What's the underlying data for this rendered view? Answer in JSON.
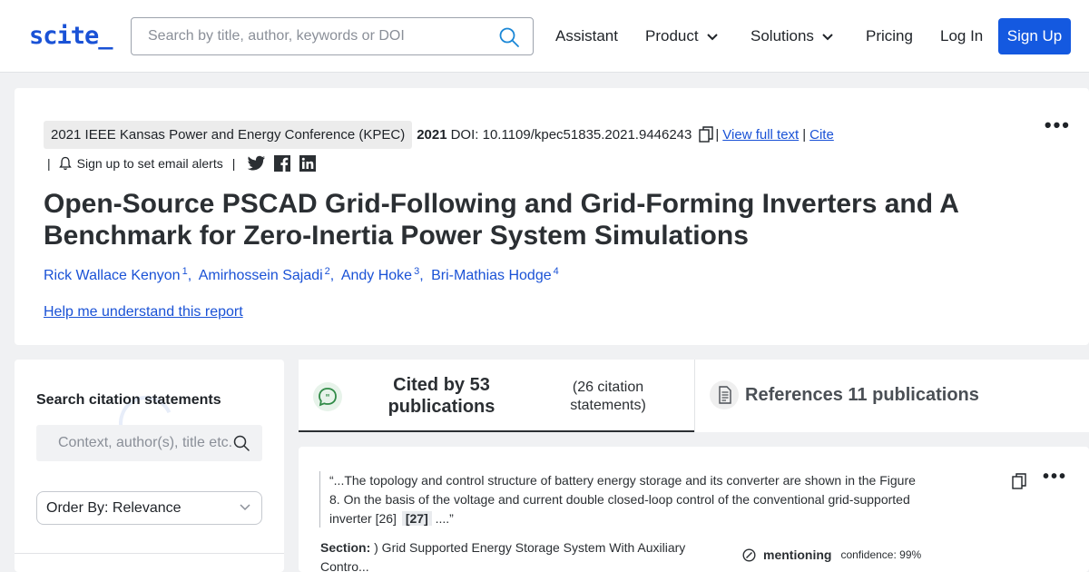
{
  "header": {
    "logo": "scite_",
    "search_placeholder": "Search by title, author, keywords or DOI",
    "nav": {
      "assistant": "Assistant",
      "product": "Product",
      "solutions": "Solutions",
      "pricing": "Pricing",
      "login": "Log In",
      "signup": "Sign Up"
    },
    "brand_color": "#1459e0"
  },
  "paper": {
    "venue": "2021 IEEE Kansas Power and Energy Conference (KPEC)",
    "year": "2021",
    "doi": "DOI: 10.1109/kpec51835.2021.9446243",
    "view_full_text": "View full text",
    "cite": "Cite",
    "sep": "|",
    "email_alerts": "Sign up to set email alerts",
    "title": "Open-Source PSCAD Grid-Following and Grid-Forming Inverters and A Benchmark for Zero-Inertia Power System Simulations",
    "authors": [
      {
        "name": "Rick Wallace Kenyon",
        "sup": "1"
      },
      {
        "name": "Amirhossein Sajadi",
        "sup": "2"
      },
      {
        "name": "Andy Hoke",
        "sup": "3"
      },
      {
        "name": "Bri-Mathias Hodge",
        "sup": "4"
      }
    ],
    "help_link": "Help me understand this report"
  },
  "sidebar": {
    "title": "Search citation statements",
    "search_placeholder": "Context, author(s), title etc.",
    "order_by": "Order By: Relevance"
  },
  "tabs": {
    "cited_by": "Cited by 53 publications",
    "citation_statements": "(26 citation statements)",
    "references": "References 11 publications"
  },
  "statement": {
    "text": "“...The topology and control structure of battery energy storage and its converter are shown in the Figure 8. On the basis of the voltage and current double closed-loop control of the conventional grid-supported inverter [26]",
    "ref": "[27]",
    "tail": "....”",
    "section_label": "Section:",
    "section_value": ") Grid Supported Energy Storage System With Auxiliary Contro...",
    "type": "mentioning",
    "confidence": "confidence: 99%"
  }
}
